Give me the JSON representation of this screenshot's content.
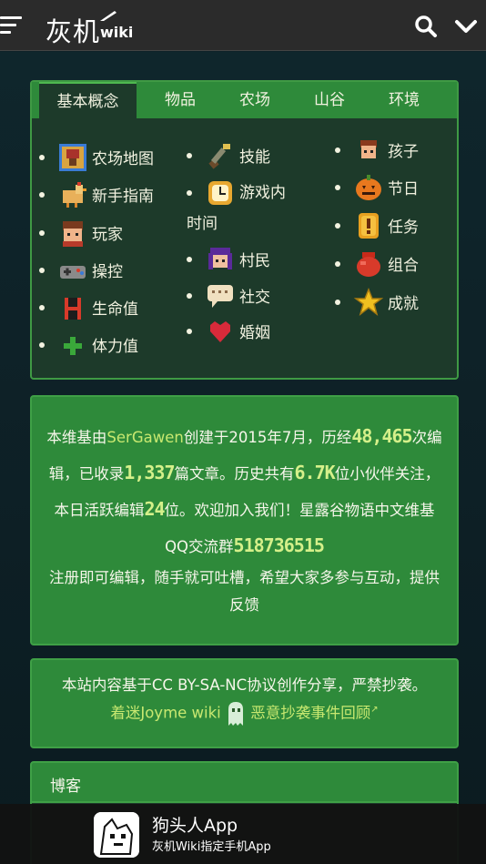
{
  "header": {
    "logo_main": "灰机",
    "logo_wiki": "wiki",
    "icons": [
      "menu-icon",
      "search-icon",
      "chevron-down-icon"
    ]
  },
  "tabs": [
    "基本概念",
    "物品",
    "农场",
    "山谷",
    "环境"
  ],
  "active_tab": "基本概念",
  "concepts": {
    "col1": [
      {
        "label": "农场地图",
        "icon": "farm-map-icon"
      },
      {
        "label": "新手指南",
        "icon": "chicken-icon"
      },
      {
        "label": "玩家",
        "icon": "player-icon"
      },
      {
        "label": "操控",
        "icon": "gamepad-icon"
      },
      {
        "label": "生命值",
        "icon": "health-icon"
      },
      {
        "label": "体力值",
        "icon": "energy-icon"
      }
    ],
    "col2": [
      {
        "label": "技能",
        "icon": "skills-icon"
      },
      {
        "label": "游戏内时间",
        "icon": "clock-icon"
      },
      {
        "label": "村民",
        "icon": "villager-icon"
      },
      {
        "label": "社交",
        "icon": "speech-icon"
      },
      {
        "label": "婚姻",
        "icon": "heart-icon"
      }
    ],
    "col3": [
      {
        "label": "孩子",
        "icon": "child-icon"
      },
      {
        "label": "节日",
        "icon": "pumpkin-icon"
      },
      {
        "label": "任务",
        "icon": "quest-icon"
      },
      {
        "label": "组合",
        "icon": "bundle-icon"
      },
      {
        "label": "成就",
        "icon": "star-icon"
      }
    ]
  },
  "stats": {
    "t1": "本维基由",
    "author": "SerGawen",
    "t2": "创建于2015年7月，历经",
    "edits": "48,465",
    "t3": "次编辑，已收录",
    "articles": "1,337",
    "t4": "篇文章。历史共有",
    "followers": "6.7K",
    "t5": "位小伙伴关注，本日活跃编辑",
    "active": "24",
    "t6": "位。欢迎加入我们！星露谷物语中文维基QQ交流群",
    "qq": "518736515",
    "p2": "注册即可编辑，随手就可吐槽，希望大家多参与互动，提供反馈"
  },
  "license": {
    "line1": "本站内容基于CC BY-SA-NC协议创作分享，严禁抄袭。",
    "link1": "着迷Joyme wiki",
    "link2": "恶意抄袭事件回顾"
  },
  "blog": {
    "title": "博客"
  },
  "app_banner": {
    "name": "狗头人App",
    "subtitle": "灰机Wiki指定手机App"
  }
}
